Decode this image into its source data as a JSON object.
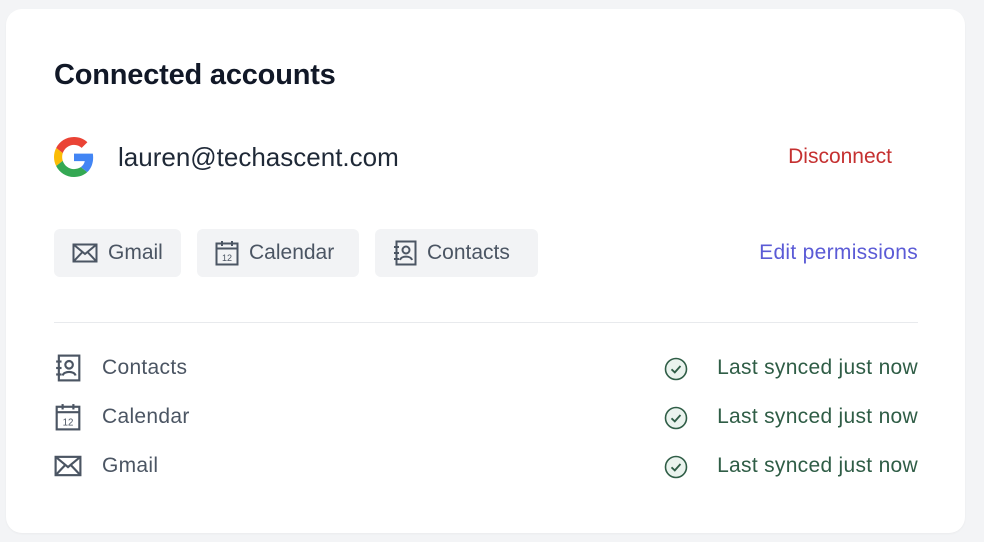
{
  "card": {
    "title": "Connected accounts",
    "account": {
      "provider_icon": "google-logo",
      "email": "lauren@techascent.com",
      "disconnect_label": "Disconnect"
    },
    "permission_chips": [
      {
        "icon": "mail-icon",
        "label": "Gmail"
      },
      {
        "icon": "calendar-icon",
        "label": "Calendar"
      },
      {
        "icon": "contacts-icon",
        "label": "Contacts"
      }
    ],
    "edit_permissions_label": "Edit permissions",
    "sync_items": [
      {
        "icon": "contacts-icon",
        "label": "Contacts",
        "status": "Last synced just now"
      },
      {
        "icon": "calendar-icon",
        "label": "Calendar",
        "status": "Last synced just now"
      },
      {
        "icon": "mail-icon",
        "label": "Gmail",
        "status": "Last synced just now"
      }
    ]
  },
  "colors": {
    "disconnect": "#c53030",
    "link": "#5b5bd6",
    "sync_status": "#2f5d46",
    "chip_bg": "#f2f3f5"
  }
}
